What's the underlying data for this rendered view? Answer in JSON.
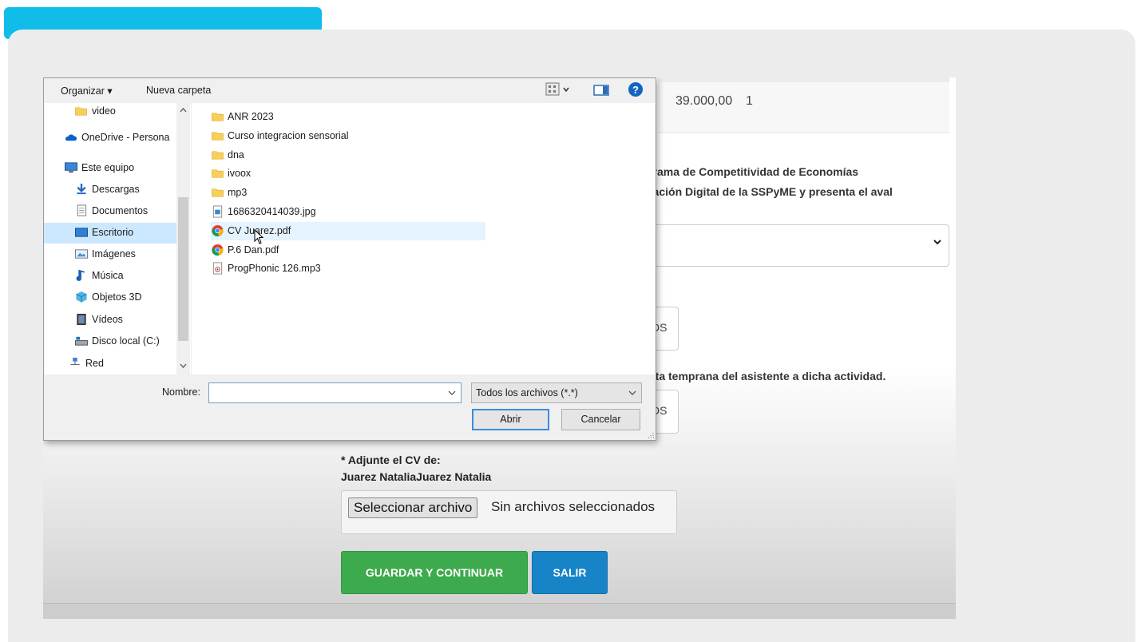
{
  "form": {
    "amount": "39.000,00",
    "quantity": "1",
    "program_line1": "grama de Competitividad de Economías",
    "program_line2": "nación Digital de la SSPyME y presenta el aval",
    "partial_box1": "DS",
    "partial_box2": "DS",
    "activity_text": "alta temprana del asistente a dicha actividad.",
    "cv_label": "* Adjunte el CV de:",
    "cv_name": "Juarez NataliaJuarez Natalia",
    "file_button": "Seleccionar archivo",
    "file_status": "Sin archivos seleccionados",
    "save_button": "GUARDAR Y CONTINUAR",
    "exit_button": "SALIR"
  },
  "dialog": {
    "toolbar": {
      "organize": "Organizar ▾",
      "new_folder": "Nueva carpeta"
    },
    "nav_items": [
      {
        "label": "video",
        "icon": "folder-icon"
      },
      {
        "label": "OneDrive - Persona",
        "icon": "cloud-icon"
      },
      {
        "label": "Este equipo",
        "icon": "computer-icon"
      },
      {
        "label": "Descargas",
        "icon": "download-icon"
      },
      {
        "label": "Documentos",
        "icon": "document-icon"
      },
      {
        "label": "Escritorio",
        "icon": "desktop-icon",
        "selected": true
      },
      {
        "label": "Imágenes",
        "icon": "images-icon"
      },
      {
        "label": "Música",
        "icon": "music-icon"
      },
      {
        "label": "Objetos 3D",
        "icon": "cube-icon"
      },
      {
        "label": "Vídeos",
        "icon": "film-icon"
      },
      {
        "label": "Disco local (C:)",
        "icon": "drive-icon"
      },
      {
        "label": "Red",
        "icon": "network-icon"
      }
    ],
    "files": [
      {
        "name": "ANR 2023",
        "type": "folder"
      },
      {
        "name": "Curso integracion sensorial",
        "type": "folder"
      },
      {
        "name": "dna",
        "type": "folder"
      },
      {
        "name": "ivoox",
        "type": "folder"
      },
      {
        "name": "mp3",
        "type": "folder"
      },
      {
        "name": "1686320414039.jpg",
        "type": "image"
      },
      {
        "name": "CV Juarez.pdf",
        "type": "pdf",
        "hovered": true
      },
      {
        "name": "P.6 Dan.pdf",
        "type": "pdf"
      },
      {
        "name": "ProgPhonic 126.mp3",
        "type": "audio"
      }
    ],
    "name_label": "Nombre:",
    "name_value": "",
    "filetype": "Todos los archivos (*.*)",
    "open_button": "Abrir",
    "cancel_button": "Cancelar"
  },
  "colors": {
    "accent_tab": "#0fbde8",
    "save": "#3dab4d",
    "exit": "#1684c6",
    "selection": "#cce8ff",
    "folder": "#f8cf5a"
  }
}
